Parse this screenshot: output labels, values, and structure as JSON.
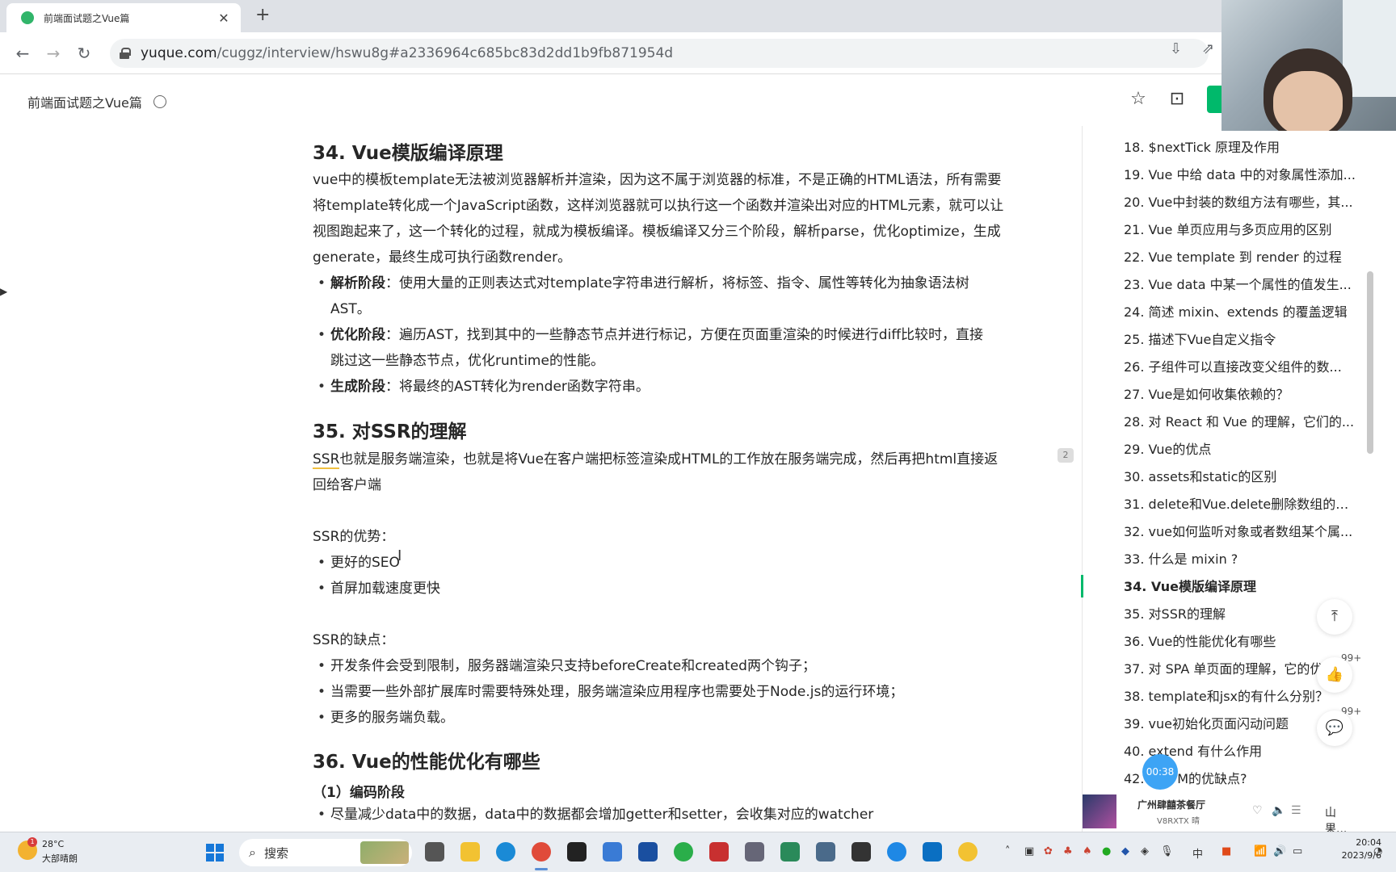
{
  "browser": {
    "tab_title": "前端面试题之Vue篇",
    "tab_close": "✕",
    "new_tab": "+",
    "url_host": "yuque.com",
    "url_path": "/cuggz/interview/hswu8g#a2336964c685bc83d2dd1b9fb871954d"
  },
  "doc": {
    "breadcrumb": "前端面试题之Vue篇"
  },
  "article": {
    "s34_title": "34. Vue模版编译原理",
    "s34_p1": "vue中的模板template无法被浏览器解析并渲染，因为这不属于浏览器的标准，不是正确的HTML语法，所有需要",
    "s34_p2": "将template转化成一个JavaScript函数，这样浏览器就可以执行这一个函数并渲染出对应的HTML元素，就可以让",
    "s34_p3": "视图跑起来了，这一个转化的过程，就成为模板编译。模板编译又分三个阶段，解析parse，优化optimize，生成",
    "s34_p4": "generate，最终生成可执行函数render。",
    "s34_b1_label": "解析阶段",
    "s34_b1_text": "：使用大量的正则表达式对template字符串进行解析，将标签、指令、属性等转化为抽象语法树",
    "s34_b1_cont": "AST。",
    "s34_b2_label": "优化阶段",
    "s34_b2_text": "：遍历AST，找到其中的一些静态节点并进行标记，方便在页面重渲染的时候进行diff比较时，直接",
    "s34_b2_cont": "跳过这一些静态节点，优化runtime的性能。",
    "s34_b3_label": "生成阶段",
    "s34_b3_text": "：将最终的AST转化为render函数字符串。",
    "s35_title": "35. 对SSR的理解",
    "s35_p1_ssr": "SSR",
    "s35_p1": "也就是服务端渲染，也就是将Vue在客户端把标签渲染成HTML的工作放在服务端完成，然后再把html直接返",
    "s35_p2": "回给客户端",
    "s35_adv_title": "SSR的优势：",
    "s35_adv1": "更好的SEO",
    "s35_adv2": "首屏加载速度更快",
    "s35_dis_title": "SSR的缺点：",
    "s35_dis1": "开发条件会受到限制，服务器端渲染只支持beforeCreate和created两个钩子；",
    "s35_dis2": "当需要一些外部扩展库时需要特殊处理，服务端渲染应用程序也需要处于Node.js的运行环境；",
    "s35_dis3": "更多的服务端负载。",
    "s36_title": "36. Vue的性能优化有哪些",
    "s36_sub": "（1）编码阶段",
    "s36_b1": "尽量减少data中的数据，data中的数据都会增加getter和setter，会收集对应的watcher",
    "comment_count": "2"
  },
  "toc": {
    "items": [
      "18. $nextTick 原理及作用",
      "19. Vue 中给 data 中的对象属性添加...",
      "20. Vue中封装的数组方法有哪些，其...",
      "21. Vue 单页应用与多页应用的区别",
      "22. Vue template 到 render 的过程",
      "23. Vue data 中某一个属性的值发生...",
      "24. 简述 mixin、extends 的覆盖逻辑",
      "25. 描述下Vue自定义指令",
      "26. 子组件可以直接改变父组件的数...",
      "27. Vue是如何收集依赖的？",
      "28. 对 React 和 Vue 的理解，它们的...",
      "29. Vue的优点",
      "30. assets和static的区别",
      "31. delete和Vue.delete删除数组的区别",
      "32. vue如何监听对象或者数组某个属...",
      "33. 什么是 mixin ?",
      "34. Vue模版编译原理",
      "35. 对SSR的理解",
      "36. Vue的性能优化有哪些",
      "37. 对 SPA 单页面的理解，它的优...",
      "38. template和jsx的有什么分别？",
      "39. vue初始化页面闪动问题",
      "40. extend 有什么作用",
      "42. MVVM的优缺点?"
    ],
    "active_index": 16,
    "like_count": "99+",
    "comment_count": "99+",
    "timer": "00:38"
  },
  "player": {
    "title": "广州肆囍茶餐厅",
    "subtitle": "V8RXTX 晴",
    "trailing": "山果..."
  },
  "taskbar": {
    "weather_badge": "1",
    "temperature": "28°C",
    "condition": "大部晴朗",
    "search_text": "搜索",
    "ime": "中",
    "time": "20:04",
    "date": "2023/9/6"
  },
  "colors": {
    "accent_green": "#00b96b",
    "timer_blue": "#3da4f5",
    "taskbar_bg": "#e9edf2"
  }
}
